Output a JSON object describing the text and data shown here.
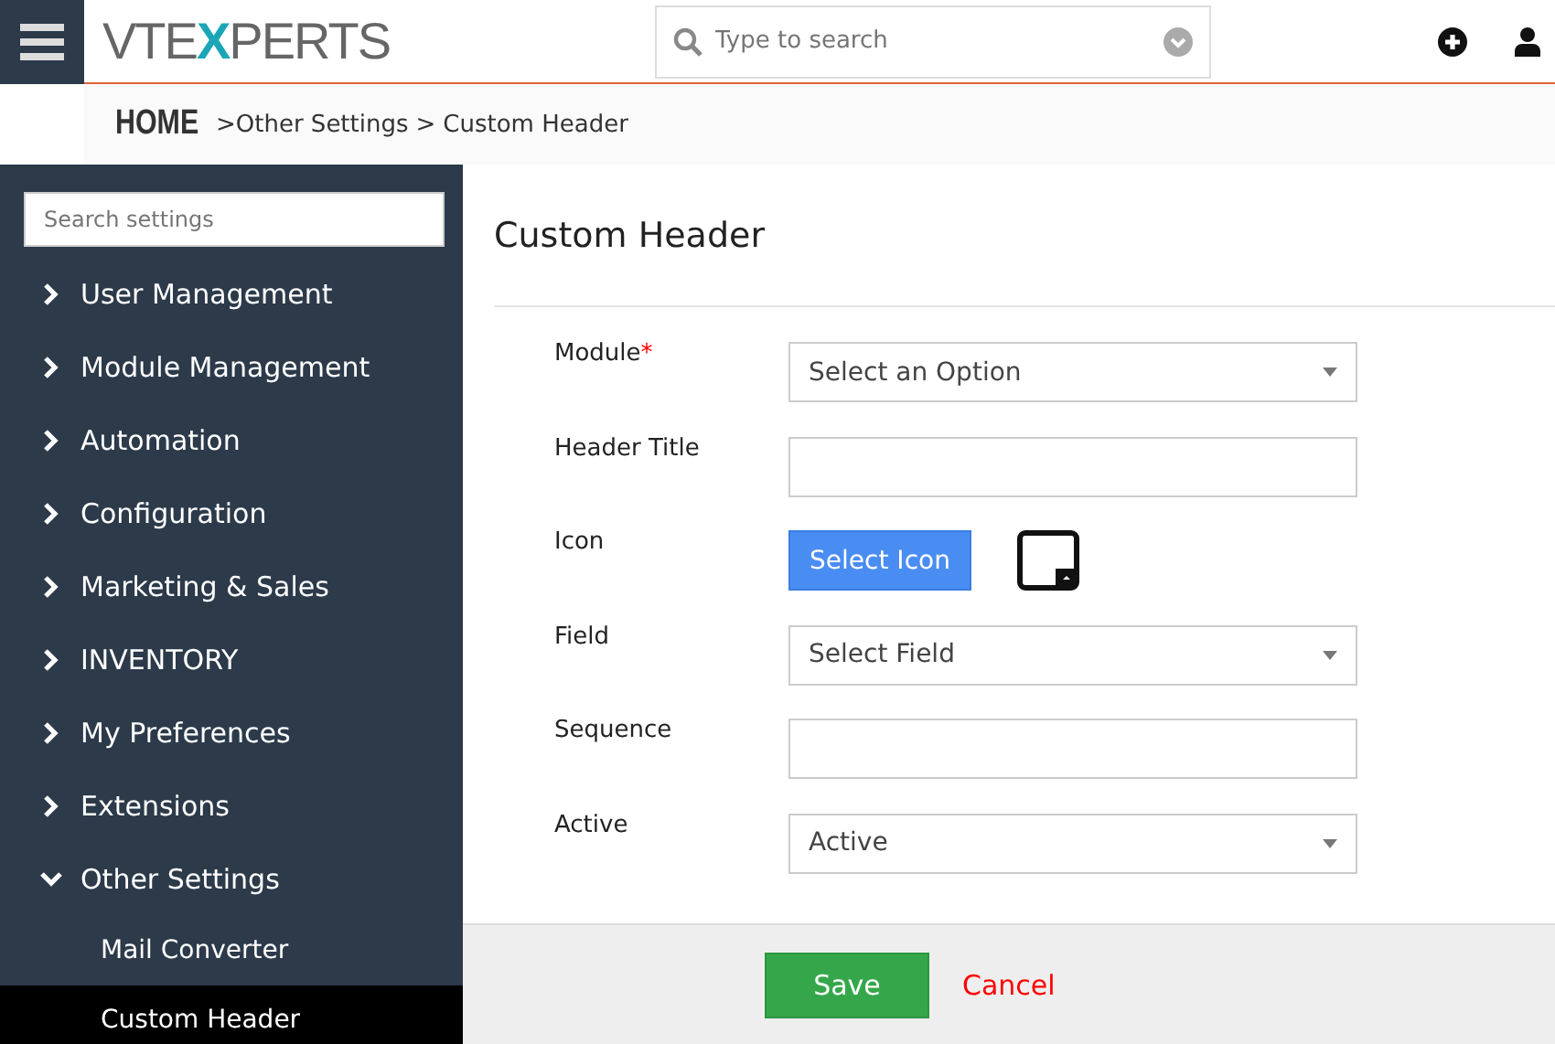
{
  "header": {
    "logo": {
      "before": "VTE",
      "accent": "X",
      "after": "PERTS"
    },
    "search": {
      "placeholder": "Type to search"
    }
  },
  "breadcrumb": {
    "home": "HOME",
    "items": [
      ">Other Settings",
      ">",
      "Custom Header"
    ]
  },
  "sidebar": {
    "search": {
      "placeholder": "Search settings"
    },
    "items": [
      {
        "label": "User Management",
        "expanded": false
      },
      {
        "label": "Module Management",
        "expanded": false
      },
      {
        "label": "Automation",
        "expanded": false
      },
      {
        "label": "Configuration",
        "expanded": false
      },
      {
        "label": "Marketing & Sales",
        "expanded": false
      },
      {
        "label": "INVENTORY",
        "expanded": false
      },
      {
        "label": "My Preferences",
        "expanded": false
      },
      {
        "label": "Extensions",
        "expanded": false
      },
      {
        "label": "Other Settings",
        "expanded": true,
        "children": [
          {
            "label": "Mail Converter",
            "selected": false
          },
          {
            "label": "Custom Header",
            "selected": true
          }
        ]
      }
    ]
  },
  "page": {
    "title": "Custom Header",
    "fields": [
      {
        "kind": "select",
        "label": "Module",
        "required_mark": "*",
        "value": "Select an Option"
      },
      {
        "kind": "text",
        "label": "Header Title"
      },
      {
        "kind": "icon",
        "label": "Icon",
        "button": "Select Icon"
      },
      {
        "kind": "select",
        "label": "Field",
        "value": "Select Field"
      },
      {
        "kind": "text",
        "label": "Sequence"
      },
      {
        "kind": "select",
        "label": "Active",
        "value": "Active"
      }
    ]
  },
  "footer": {
    "save": "Save",
    "cancel": "Cancel"
  }
}
